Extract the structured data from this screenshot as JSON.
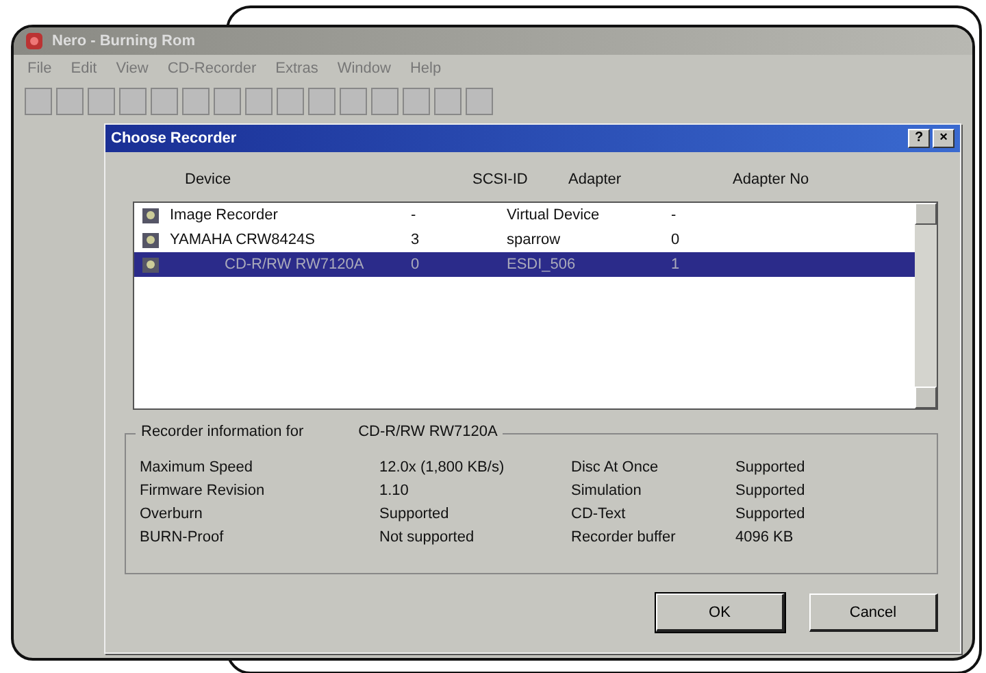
{
  "app_window": {
    "title": "Nero - Burning Rom",
    "menu": [
      "File",
      "Edit",
      "View",
      "CD-Recorder",
      "Extras",
      "Window",
      "Help"
    ]
  },
  "dialog": {
    "title": "Choose Recorder",
    "title_buttons": [
      "?",
      "×"
    ],
    "columns": [
      "Device",
      "SCSI-ID",
      "Adapter",
      "Adapter No"
    ],
    "rows": [
      {
        "device": "Image Recorder",
        "scsi_id": "-",
        "adapter": "Virtual Device",
        "adapter_no": "-",
        "selected": false
      },
      {
        "device": "YAMAHA  CRW8424S",
        "scsi_id": "3",
        "adapter": "sparrow",
        "adapter_no": "0",
        "selected": false
      },
      {
        "device": "CD-R/RW RW7120A",
        "scsi_id": "0",
        "adapter": "ESDI_506",
        "adapter_no": "1",
        "selected": true
      }
    ],
    "info": {
      "label": "Recorder information for",
      "device": "CD-R/RW RW7120A",
      "rows": [
        [
          "Maximum Speed",
          "12.0x (1,800 KB/s)",
          "Disc At Once",
          "Supported"
        ],
        [
          "Firmware Revision",
          "1.10",
          "Simulation",
          "Supported"
        ],
        [
          "Overburn",
          "Supported",
          "CD-Text",
          "Supported"
        ],
        [
          "BURN-Proof",
          "Not supported",
          "Recorder buffer",
          "4096 KB"
        ]
      ]
    },
    "buttons": [
      "OK",
      "Cancel"
    ]
  }
}
